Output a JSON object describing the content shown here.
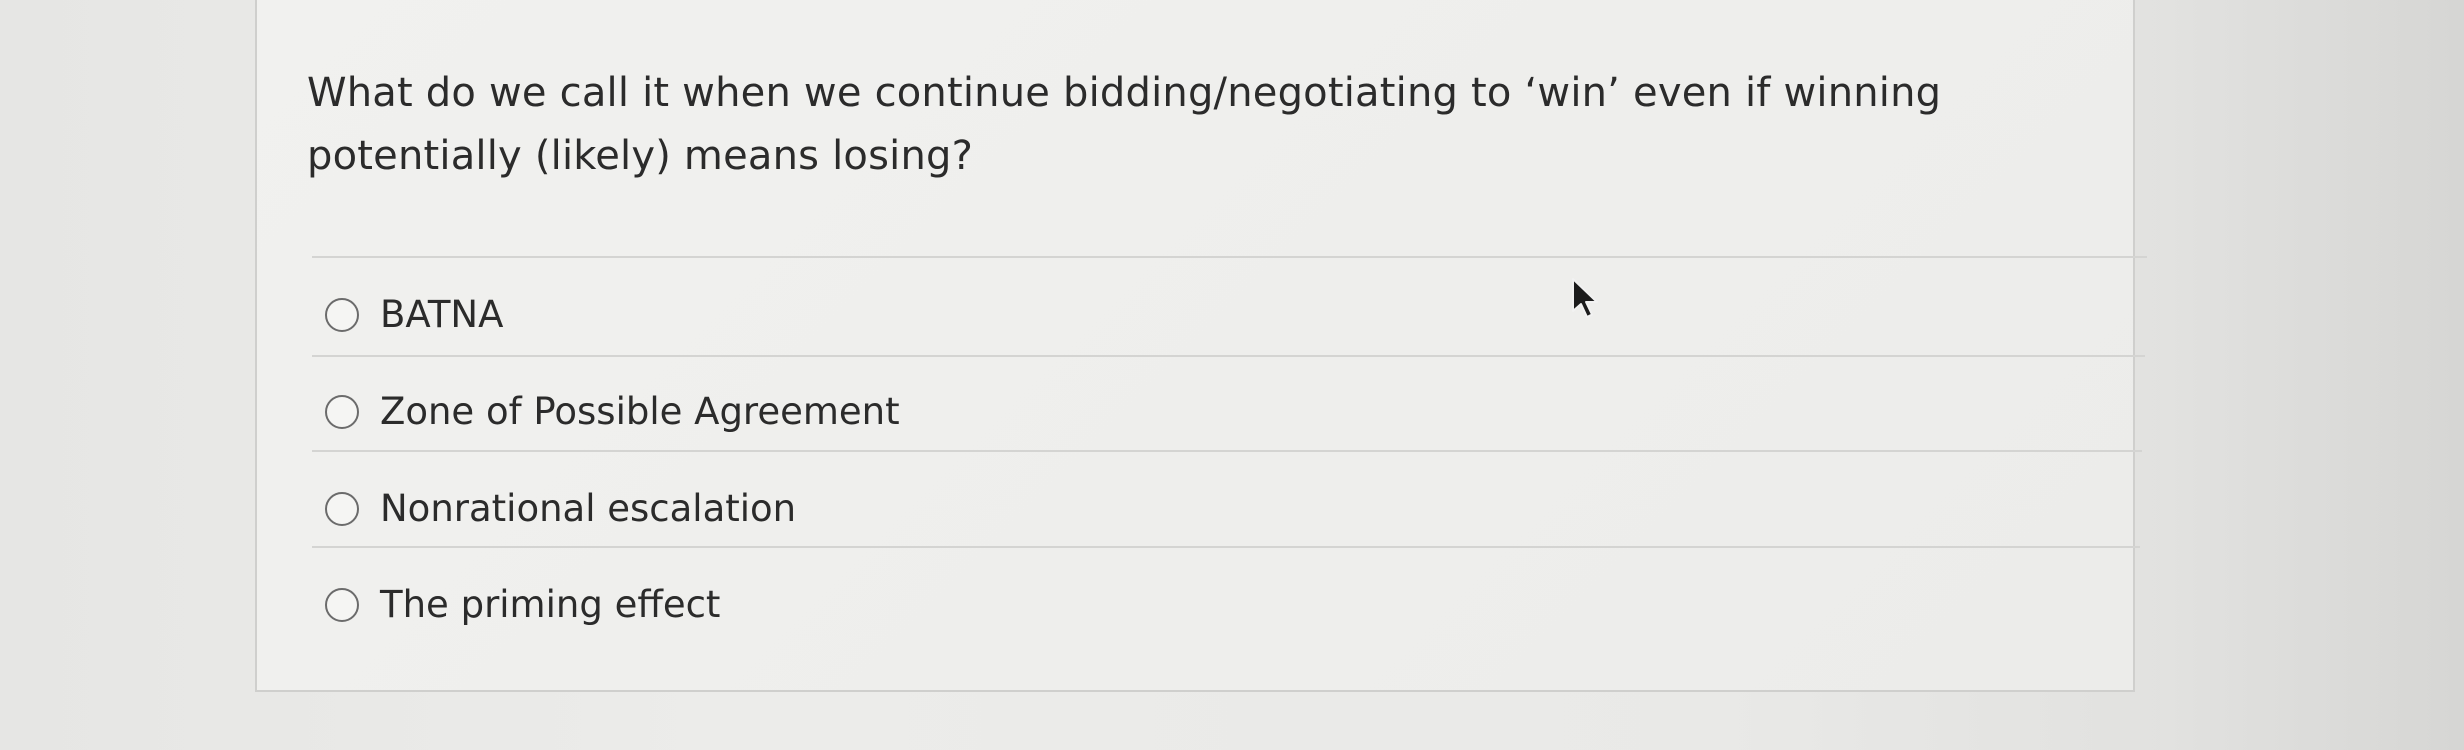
{
  "question": {
    "text": "What do we call it when we continue bidding/negotiating to ‘win’ even if winning potentially (likely) means losing?"
  },
  "options": [
    {
      "label": "BATNA",
      "selected": false
    },
    {
      "label": "Zone of Possible Agreement",
      "selected": false
    },
    {
      "label": "Nonrational escalation",
      "selected": false
    },
    {
      "label": "The priming effect",
      "selected": false
    }
  ],
  "cursor": {
    "icon": "mouse-pointer-icon"
  }
}
